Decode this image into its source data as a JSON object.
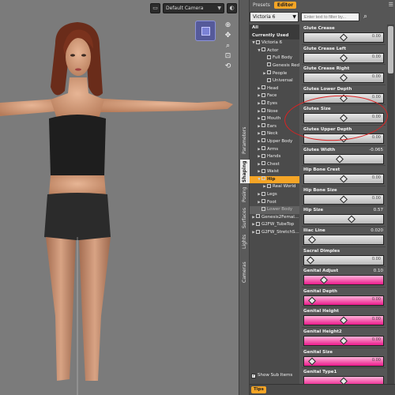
{
  "viewport": {
    "camera_label": "Default Camera",
    "camera_caret": "▼"
  },
  "vertical_tabs": [
    "Parameters",
    "Shaping",
    "Posing",
    "Surfaces",
    "Lights",
    "Cameras"
  ],
  "pane": {
    "tabs": [
      "Presets",
      "Editor"
    ],
    "active_tab": "Editor",
    "figure_select": "Victoria 6",
    "filter_placeholder": "Enter text to filter by...",
    "show_sub_items": "Show Sub Items",
    "tips_label": "Tips"
  },
  "tree": [
    {
      "label": "All",
      "level": 0,
      "type": "head"
    },
    {
      "label": "Currently Used",
      "level": 0,
      "type": "head"
    },
    {
      "label": "Victoria 6",
      "level": 0,
      "type": "node",
      "open": true
    },
    {
      "label": "Actor",
      "level": 1,
      "type": "node",
      "open": true
    },
    {
      "label": "Full Body",
      "level": 2,
      "type": "leaf"
    },
    {
      "label": "Genesis Redux",
      "level": 2,
      "type": "leaf"
    },
    {
      "label": "People",
      "level": 2,
      "type": "node"
    },
    {
      "label": "Universal",
      "level": 2,
      "type": "leaf"
    },
    {
      "label": "Head",
      "level": 1,
      "type": "node"
    },
    {
      "label": "Face",
      "level": 1,
      "type": "node"
    },
    {
      "label": "Eyes",
      "level": 1,
      "type": "node"
    },
    {
      "label": "Nose",
      "level": 1,
      "type": "node"
    },
    {
      "label": "Mouth",
      "level": 1,
      "type": "node"
    },
    {
      "label": "Ears",
      "level": 1,
      "type": "node"
    },
    {
      "label": "Neck",
      "level": 1,
      "type": "node"
    },
    {
      "label": "Upper Body",
      "level": 1,
      "type": "node"
    },
    {
      "label": "Arms",
      "level": 1,
      "type": "node"
    },
    {
      "label": "Hands",
      "level": 1,
      "type": "node"
    },
    {
      "label": "Chest",
      "level": 1,
      "type": "node"
    },
    {
      "label": "Waist",
      "level": 1,
      "type": "node"
    },
    {
      "label": "Hip",
      "level": 1,
      "type": "node",
      "open": true,
      "selected": true
    },
    {
      "label": "Real World",
      "level": 2,
      "type": "node"
    },
    {
      "label": "Legs",
      "level": 1,
      "type": "node"
    },
    {
      "label": "Foot",
      "level": 1,
      "type": "node"
    },
    {
      "label": "Lower Body",
      "level": 1,
      "type": "leaf",
      "dim": true
    },
    {
      "label": "Genesis2Femal...",
      "level": 0,
      "type": "node"
    },
    {
      "label": "G2FW_TubeTop",
      "level": 0,
      "type": "node"
    },
    {
      "label": "G2FW_StretchS...",
      "level": 0,
      "type": "node"
    }
  ],
  "sliders": [
    {
      "label": "Glute Crease",
      "value": "",
      "track_value": "0.00",
      "pos": 0.5,
      "style": "gray"
    },
    {
      "label": "Glute Crease Left",
      "value": "",
      "track_value": "0.00",
      "pos": 0.5,
      "style": "gray"
    },
    {
      "label": "Glute Crease Right",
      "value": "",
      "track_value": "0.00",
      "pos": 0.5,
      "style": "gray"
    },
    {
      "label": "Glutes Lower Depth",
      "value": "",
      "track_value": "0.00",
      "pos": 0.5,
      "style": "gray"
    },
    {
      "label": "Glutes Size",
      "value": "",
      "track_value": "0.00",
      "pos": 0.5,
      "style": "gray"
    },
    {
      "label": "Glutes Upper Depth",
      "value": "",
      "track_value": "0.00",
      "pos": 0.5,
      "style": "gray"
    },
    {
      "label": "Glutes Width",
      "value": "-0.065",
      "track_value": "",
      "pos": 0.45,
      "style": "gray"
    },
    {
      "label": "Hip Bone Crest",
      "value": "",
      "track_value": "0.00",
      "pos": 0.5,
      "style": "gray"
    },
    {
      "label": "Hip Bone Size",
      "value": "",
      "track_value": "0.00",
      "pos": 0.5,
      "style": "gray"
    },
    {
      "label": "Hip Size",
      "value": "0.57",
      "track_value": "",
      "pos": 0.6,
      "style": "gray"
    },
    {
      "label": "Iliac Line",
      "value": "0.020",
      "track_value": "",
      "pos": 0.1,
      "style": "gray"
    },
    {
      "label": "Sacral Dimples",
      "value": "",
      "track_value": "0.00",
      "pos": 0.08,
      "style": "gray"
    },
    {
      "label": "Genital Adjust",
      "value": "0.10",
      "track_value": "",
      "pos": 0.25,
      "style": "pink"
    },
    {
      "label": "Genital Depth",
      "value": "",
      "track_value": "0.00",
      "pos": 0.1,
      "style": "pink"
    },
    {
      "label": "Genital Height",
      "value": "",
      "track_value": "0.00",
      "pos": 0.5,
      "style": "pink"
    },
    {
      "label": "Genital Height2",
      "value": "",
      "track_value": "0.00",
      "pos": 0.5,
      "style": "pink"
    },
    {
      "label": "Genital Size",
      "value": "",
      "track_value": "0.00",
      "pos": 0.1,
      "style": "pink"
    },
    {
      "label": "Genital Type1",
      "value": "",
      "track_value": "",
      "pos": 0.5,
      "style": "pink"
    }
  ]
}
